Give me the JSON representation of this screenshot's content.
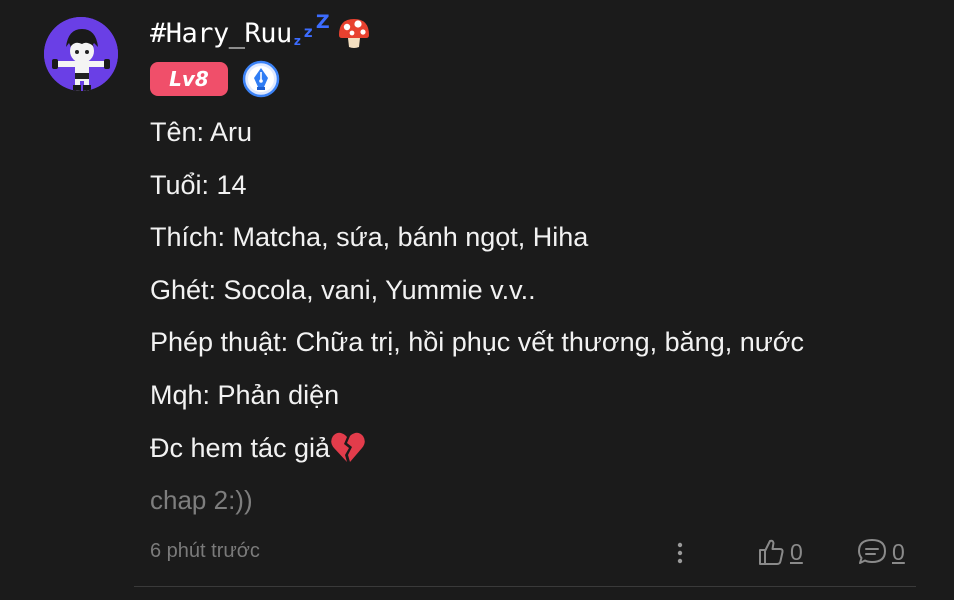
{
  "author": {
    "username": "#Hary_Ruu",
    "sleep_letters": [
      "z",
      "z",
      "Z"
    ],
    "avatar_icon": "anime-character-avatar",
    "level": "Lv8",
    "badge_icon": "pen-nib-badge-icon",
    "emoji": "mushroom"
  },
  "content": {
    "lines": [
      "Tên: Aru",
      "Tuổi: 14",
      "Thích: Matcha, sứa, bánh ngọt, Hiha",
      "Ghét: Socola, vani, Yummie v.v..",
      "Phép thuật: Chữa trị, hồi phục vết thương, băng, nước",
      "Mqh: Phản diện",
      "Đc hem tác giả"
    ],
    "trailing_emoji": "broken-heart",
    "muted_line": "chap 2:))"
  },
  "footer": {
    "timestamp": "6 phút trước",
    "likes": "0",
    "replies": "0"
  },
  "colors": {
    "background": "#1b1b1b",
    "level_badge": "#f04f6a",
    "zzz": "#3c6cff",
    "avatar_bg": "#6a3fe6"
  }
}
